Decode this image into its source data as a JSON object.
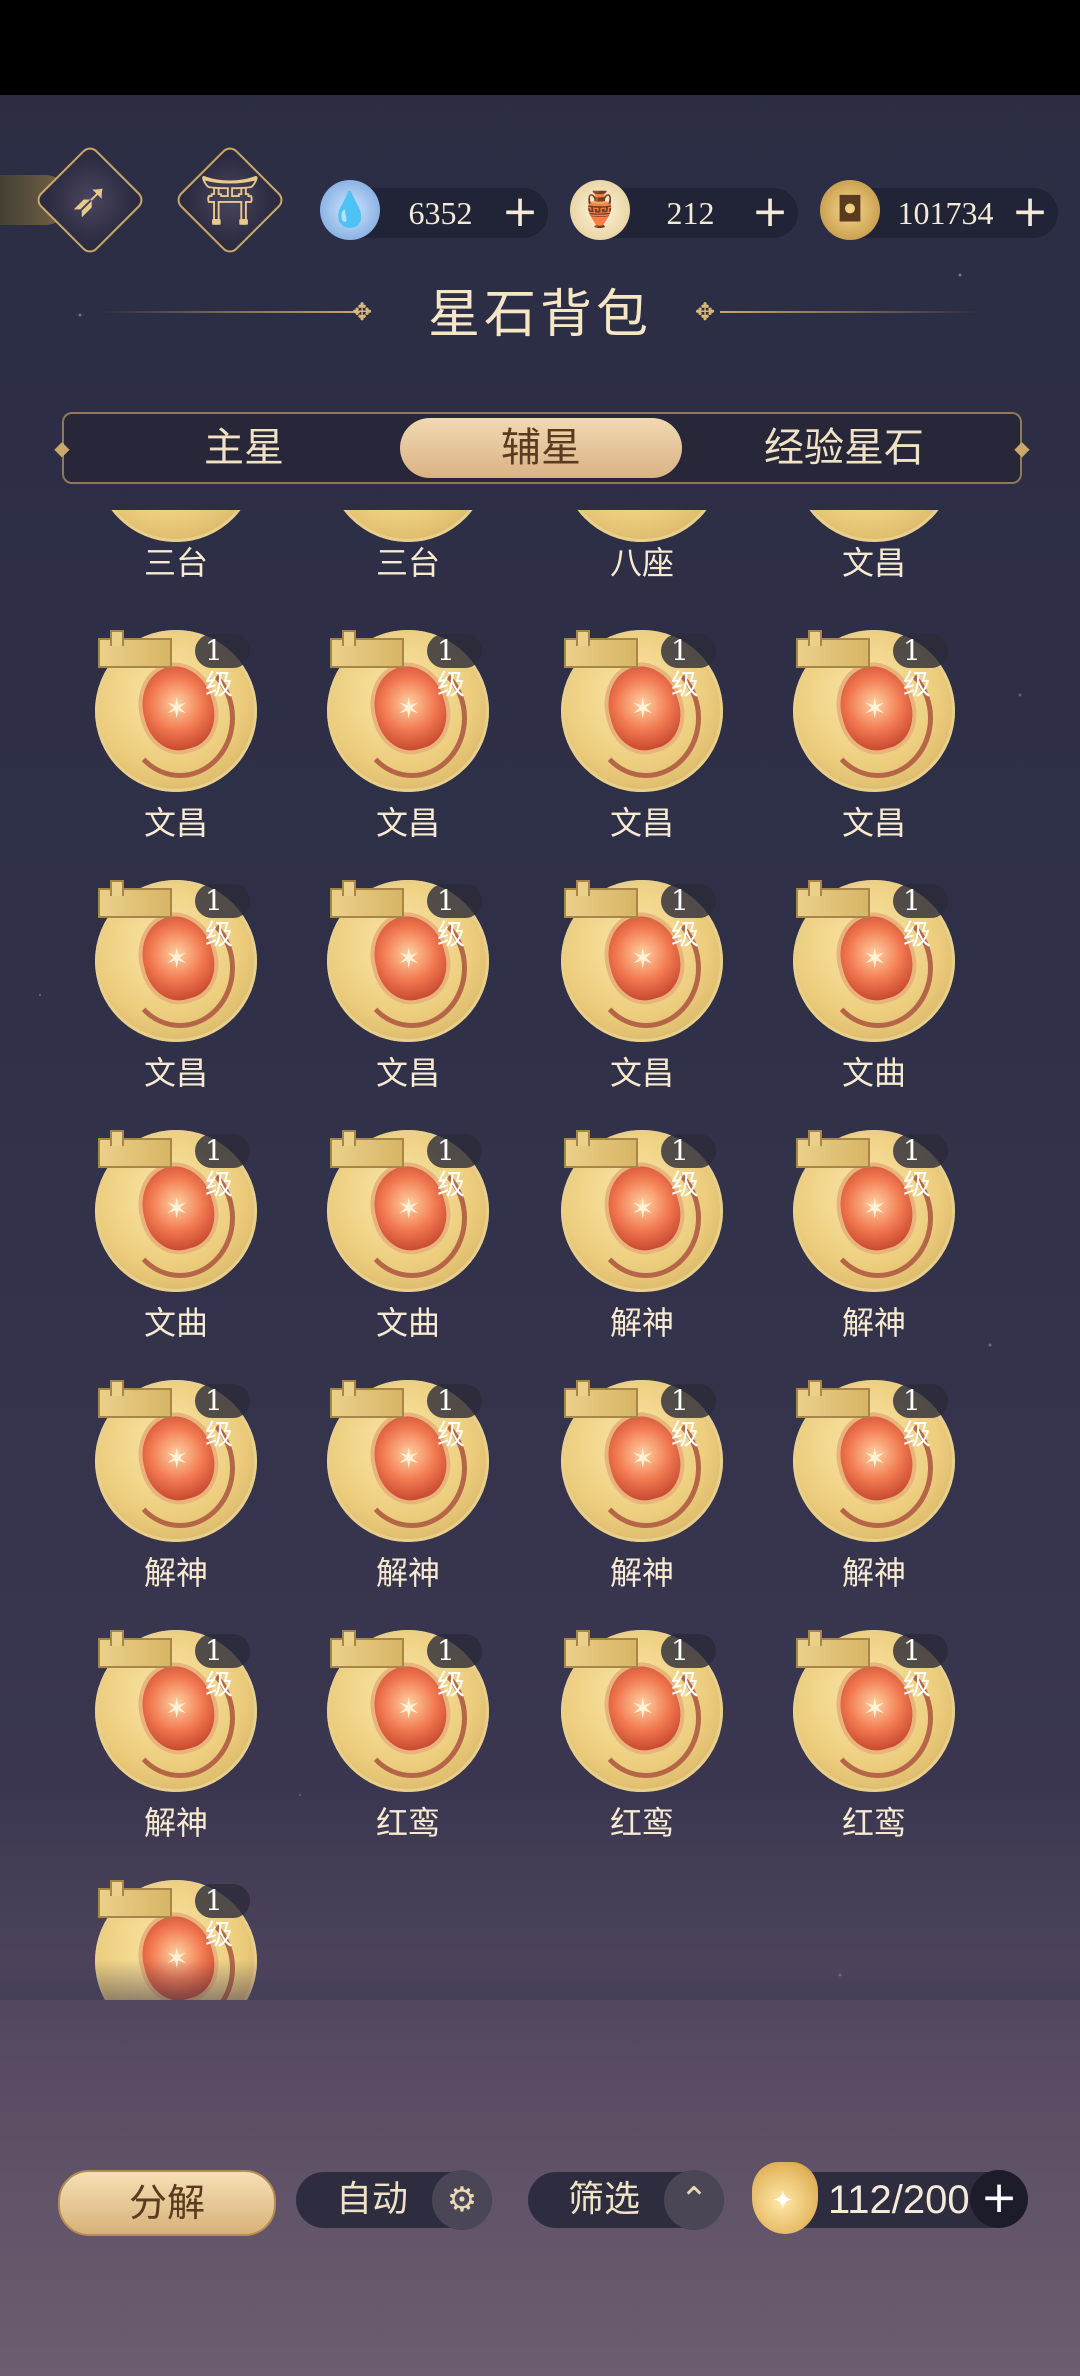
{
  "header": {
    "title": "星石背包",
    "currencies": [
      {
        "name": "water-drop-icon",
        "value": "6352"
      },
      {
        "name": "gourd-icon",
        "value": "212"
      },
      {
        "name": "copper-coin-icon",
        "value": "101734"
      }
    ],
    "plus": "+"
  },
  "tabs": [
    {
      "label": "主星"
    },
    {
      "label": "辅星"
    },
    {
      "label": "经验星石"
    }
  ],
  "grid": {
    "partial_row": [
      "三台",
      "三台",
      "八座",
      "文昌"
    ],
    "level_label": "1级",
    "items": [
      "文昌",
      "文昌",
      "文昌",
      "文昌",
      "文昌",
      "文昌",
      "文昌",
      "文曲",
      "文曲",
      "文曲",
      "解神",
      "解神",
      "解神",
      "解神",
      "解神",
      "解神",
      "解神",
      "红鸾",
      "红鸾",
      "红鸾",
      ""
    ]
  },
  "bottom": {
    "decompose_label": "分解",
    "auto_label": "自动",
    "filter_label": "筛选",
    "capacity": "112/200",
    "plus": "+"
  },
  "colors": {
    "accent_gold": "#d9b384",
    "background": "#2f3048"
  }
}
